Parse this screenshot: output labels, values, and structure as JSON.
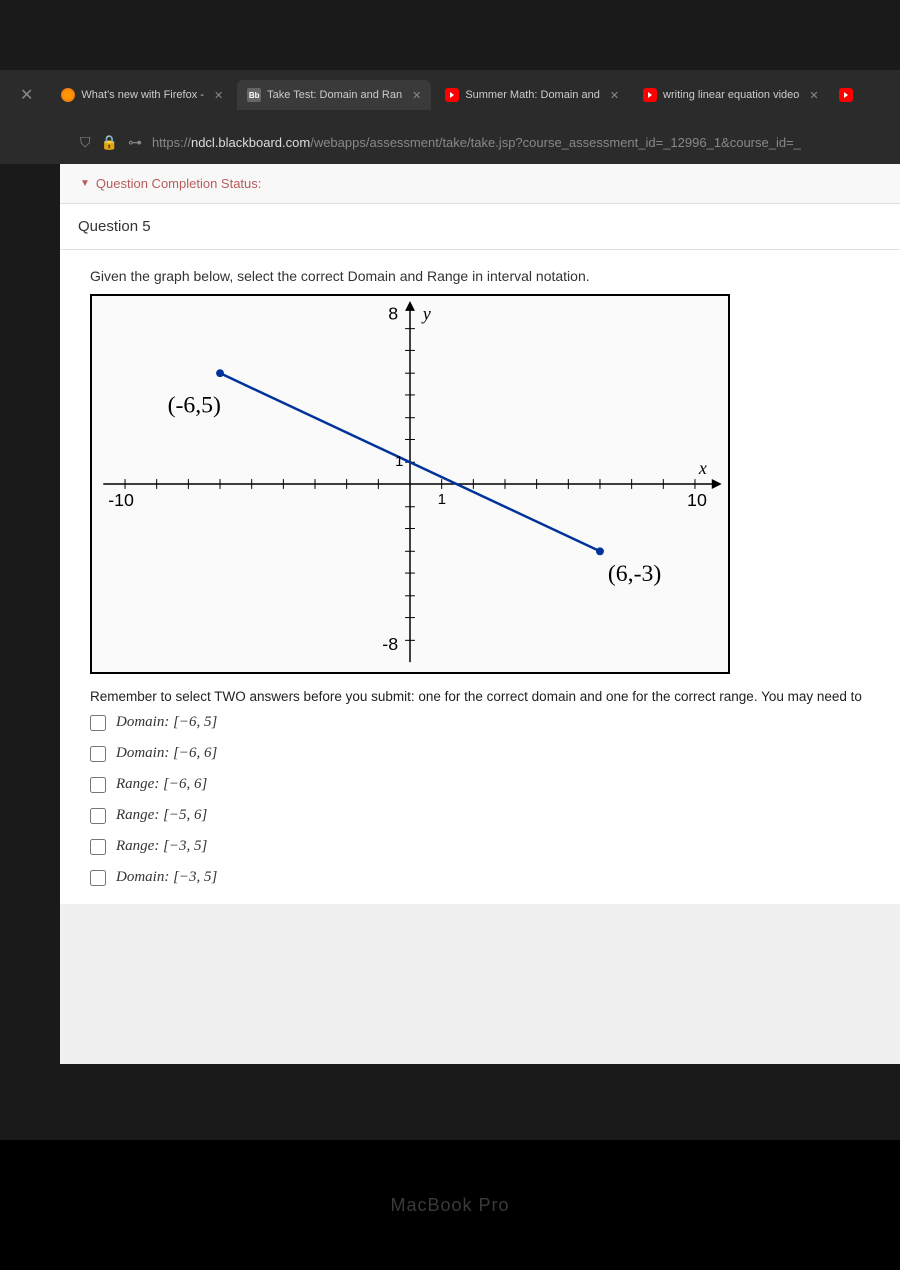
{
  "tabs": [
    {
      "label": "What's new with Firefox - ",
      "icon": "firefox"
    },
    {
      "label": "Take Test: Domain and Ran",
      "icon": "bb",
      "active": true
    },
    {
      "label": "Summer Math: Domain and",
      "icon": "yt"
    },
    {
      "label": "writing linear equation video",
      "icon": "yt"
    }
  ],
  "url": {
    "protocol": "https://",
    "domain": "ndcl.blackboard.com",
    "path": "/webapps/assessment/take/take.jsp?course_assessment_id=_12996_1&course_id=_"
  },
  "completion_status": "Question Completion Status:",
  "question_number": "Question 5",
  "question_prompt": "Given the graph below, select the correct Domain and Range in interval notation.",
  "graph": {
    "point1_label": "(-6,5)",
    "point2_label": "(6,-3)",
    "x_min_label": "-10",
    "x_max_label": "10",
    "y_max_label": "8",
    "y_min_label": "-8",
    "x_axis_label": "x",
    "y_axis_label": "y",
    "origin_label": "1",
    "origin_y_label": "1"
  },
  "chart_data": {
    "type": "line",
    "series": [
      {
        "name": "segment",
        "points": [
          {
            "x": -6,
            "y": 5
          },
          {
            "x": 6,
            "y": -3
          }
        ]
      }
    ],
    "xlim": [
      -10,
      10
    ],
    "ylim": [
      -8,
      8
    ],
    "xlabel": "x",
    "ylabel": "y",
    "annotations": [
      "(-6,5)",
      "(6,-3)"
    ]
  },
  "instruction": "Remember to select TWO answers before you submit: one for the correct domain and one for the correct range. You may need to",
  "options": [
    {
      "type": "Domain",
      "interval": "[−6, 5]"
    },
    {
      "type": "Domain",
      "interval": "[−6, 6]"
    },
    {
      "type": "Range",
      "interval": "[−6, 6]"
    },
    {
      "type": "Range",
      "interval": "[−5, 6]"
    },
    {
      "type": "Range",
      "interval": "[−3, 5]"
    },
    {
      "type": "Domain",
      "interval": "[−3, 5]"
    }
  ],
  "macbook": "MacBook Pro"
}
